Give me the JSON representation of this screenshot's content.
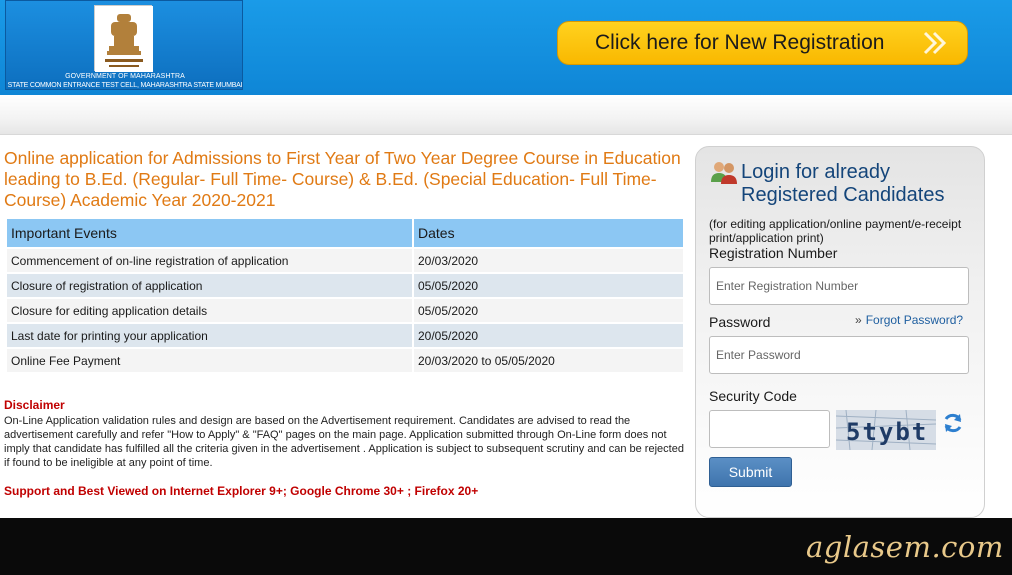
{
  "header": {
    "logo_text_line1": "GOVERNMENT OF MAHARASHTRA",
    "logo_text_line2": "STATE COMMON ENTRANCE TEST CELL, MAHARASHTRA STATE MUMBAI",
    "new_registration_label": "Click here for New Registration",
    "brand_color": "#1a9be8",
    "button_color": "#ffc20e"
  },
  "main": {
    "title": "Online application for Admissions to First Year of Two Year Degree Course in Education leading to B.Ed. (Regular- Full Time- Course) & B.Ed. (Special Education- Full Time-Course) Academic Year 2020-2021",
    "table": {
      "headers": [
        "Important Events",
        "Dates"
      ],
      "rows": [
        {
          "event": "Commencement of on-line registration of application",
          "date": "20/03/2020"
        },
        {
          "event": "Closure of registration of application",
          "date": "05/05/2020"
        },
        {
          "event": "Closure for editing application details",
          "date": "05/05/2020"
        },
        {
          "event": "Last date for printing your application",
          "date": "20/05/2020"
        },
        {
          "event": "Online Fee Payment",
          "date": "20/03/2020 to 05/05/2020"
        }
      ]
    },
    "disclaimer_title": "Disclaimer",
    "disclaimer_text": "On-Line Application validation rules and design are based on the Advertisement requirement. Candidates are advised to read the advertisement carefully and refer \"How to Apply\" & \"FAQ\" pages on the main page. Application submitted through On-Line form does not imply that candidate has fulfilled all the criteria given in the advertisement . Application is subject to subsequent scrutiny and can be rejected if found to be ineligible at any point of time.",
    "support_note": "Support and Best Viewed on Internet Explorer 9+; Google Chrome 30+ ; Firefox 20+"
  },
  "login": {
    "title": "Login for already Registered Candidates",
    "subtitle": "(for editing application/online payment/e-receipt print/application print)",
    "registration_label": "Registration Number",
    "registration_placeholder": "Enter Registration Number",
    "password_label": "Password",
    "password_placeholder": "Enter Password",
    "forgot_label": "Forgot Password?",
    "security_label": "Security Code",
    "captcha_text": "5tybt",
    "submit_label": "Submit"
  },
  "footer": {
    "watermark": "aglasem.com"
  }
}
